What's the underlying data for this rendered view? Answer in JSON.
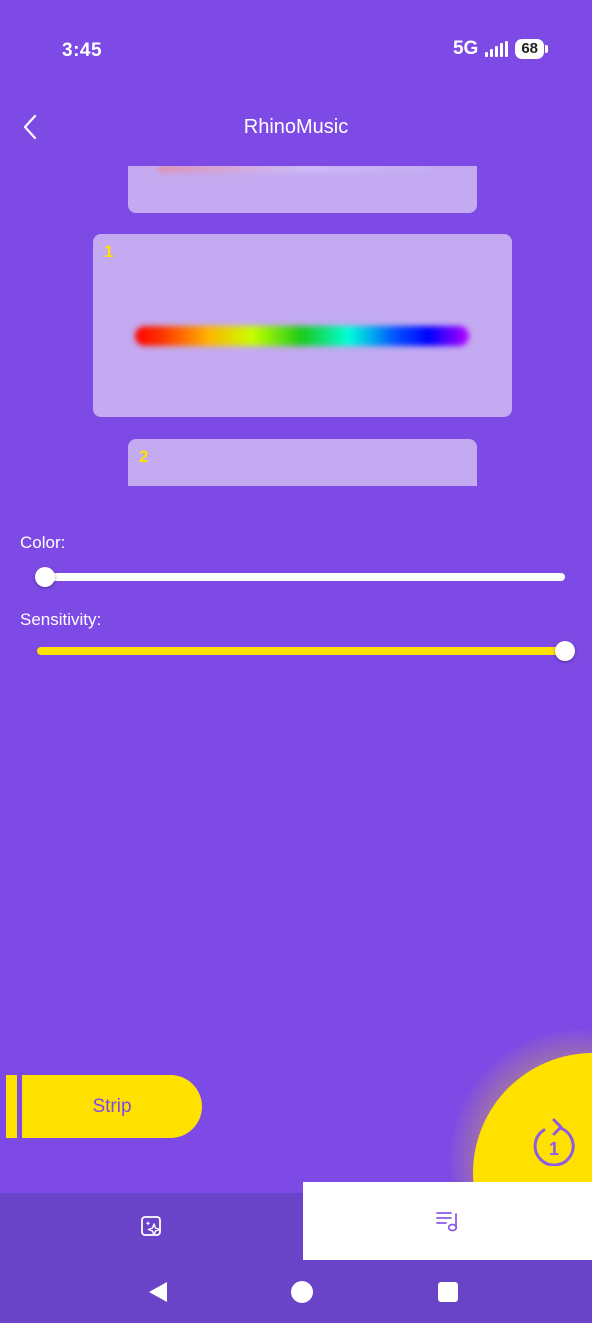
{
  "status_bar": {
    "time": "3:45",
    "network": "5G",
    "battery": "68"
  },
  "header": {
    "title": "RhinoMusic"
  },
  "strips": {
    "main_index": "1",
    "next_index": "2"
  },
  "controls": {
    "color_label": "Color:",
    "color_value_percent": 0,
    "sensitivity_label": "Sensitivity:",
    "sensitivity_value_percent": 100
  },
  "strip_button": {
    "label": "Strip"
  },
  "fab": {
    "icon": "replay-one-icon",
    "badge": "1"
  },
  "tabs": [
    {
      "icon": "sparkle-image-icon",
      "active": false
    },
    {
      "icon": "music-list-icon",
      "active": true
    }
  ],
  "colors": {
    "background": "#7E4AE6",
    "accent_yellow": "#FFE100",
    "card": "#C4AAF1",
    "nav": "#6A44C8"
  }
}
